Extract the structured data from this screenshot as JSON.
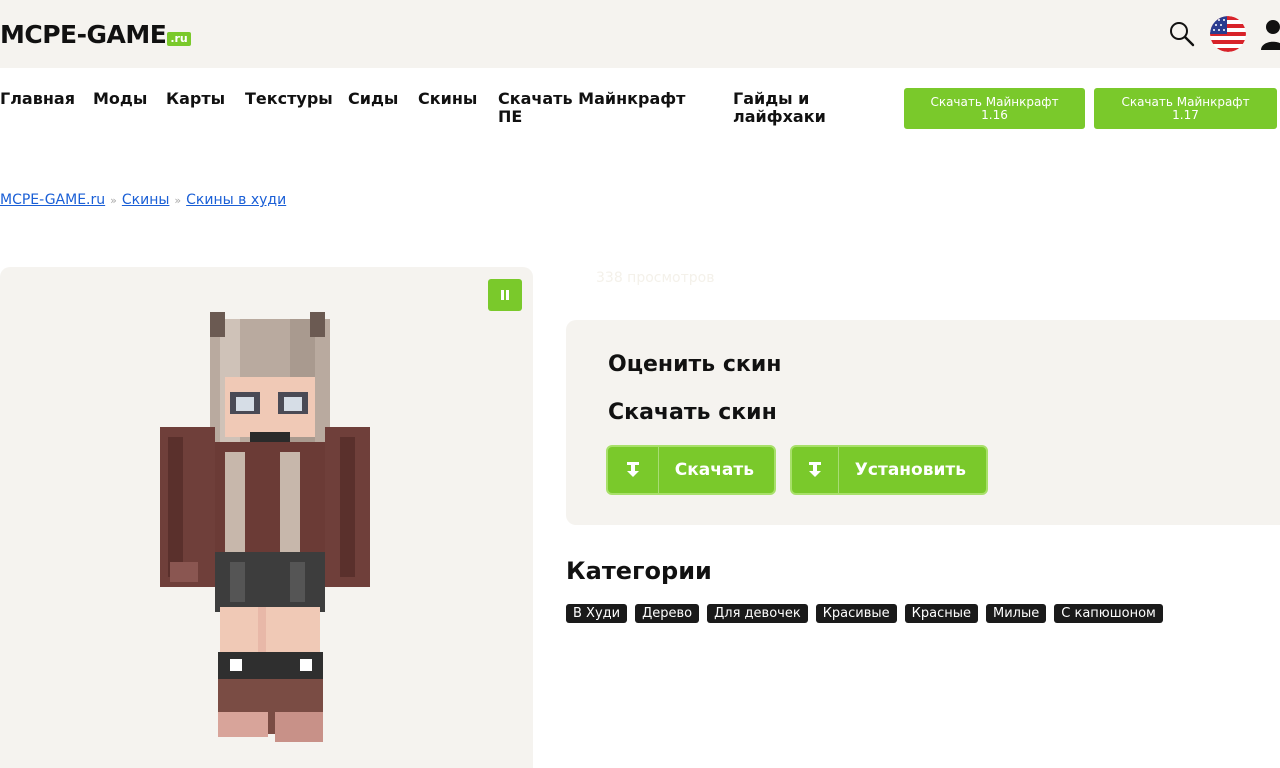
{
  "header": {
    "logo_text": "MCPE-GAME",
    "logo_tld": ".ru",
    "icons": [
      "search-icon",
      "us-flag-icon",
      "user-icon"
    ]
  },
  "nav": {
    "items": [
      "Главная",
      "Моды",
      "Карты",
      "Текстуры",
      "Сиды",
      "Скины",
      "Скачать Майнкрафт ПЕ",
      "Гайды и лайфхаки"
    ],
    "download_buttons": [
      {
        "line1": "Скачать Майнкрафт",
        "line2": "1.16"
      },
      {
        "line1": "Скачать Майнкрафт",
        "line2": "1.17"
      }
    ]
  },
  "breadcrumb": {
    "items": [
      "MCPE-GAME.ru",
      "Скины",
      "Скины в худи"
    ],
    "separator": "»"
  },
  "skin": {
    "views": "338 просмотров",
    "rate_label": "Оценить скин",
    "download_label": "Скачать скин",
    "download_button": "Скачать",
    "install_button": "Установить"
  },
  "categories": {
    "title": "Категории",
    "tags": [
      "В Худи",
      "Дерево",
      "Для девочек",
      "Красивые",
      "Красные",
      "Милые",
      "С капюшоном"
    ]
  },
  "colors": {
    "accent": "#7ac92b",
    "panel": "#f5f3ef",
    "link": "#1a5fd6",
    "tag_bg": "#1a1a1a"
  }
}
